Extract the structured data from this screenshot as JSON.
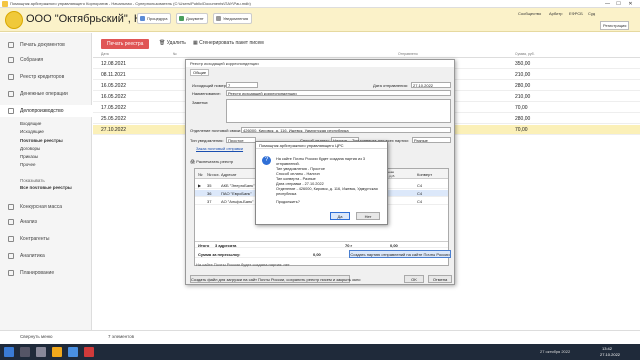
{
  "titlebar": {
    "title": "Помощник арбитражного управляющего Корпоратив - Начальная - Суперпользователь (C:\\Users\\Public\\Documents\\ПАУ\\Pau.mdb)",
    "min": "—",
    "max": "☐",
    "close": "✕"
  },
  "header": {
    "company": "ООО \"Октябрьский\", КП",
    "buttons": [
      "Процедура",
      "Документ",
      "Уведомления"
    ],
    "right": [
      "Сообщество",
      "Арбитр",
      "ЕФРСБ",
      "Суд",
      "Регистрация"
    ],
    "accent": "#e05555"
  },
  "sidebar": {
    "items": [
      "Печать документов",
      "Собрания",
      "Реестр кредиторов",
      "Денежные операции",
      "Делопроизводство",
      "Конкурсная масса",
      "Анализ",
      "Контрагенты",
      "Аналитика",
      "Планирование"
    ],
    "subitems": [
      "Входящие",
      "Исходящие",
      "Почтовые реестры",
      "Договоры",
      "Приказы",
      "Прочее"
    ],
    "show_label": "Показывать",
    "show_value": "Все почтовые реестры",
    "collapse": "Свернуть меню"
  },
  "main": {
    "print_btn": "Печать реестра",
    "delete_btn": "Удалить",
    "generate_btn": "Сгенерировать пакет писем",
    "headers": [
      "Дата",
      "№",
      "Отправлено",
      "Сумма, руб."
    ],
    "rows": [
      [
        "12.08.2021",
        "350,00"
      ],
      [
        "08.11.2021",
        "210,00"
      ],
      [
        "16.05.2022",
        "280,00"
      ],
      [
        "16.05.2022",
        "210,00"
      ],
      [
        "17.05.2022",
        "70,00"
      ],
      [
        "25.05.2022",
        "280,00"
      ],
      [
        "27.10.2022",
        "70,00"
      ]
    ],
    "footer": "7 элементов"
  },
  "dialog": {
    "title": "Реестр исходящей корреспонденции",
    "tab": "Общие",
    "outnum_label": "Исходящий номер:",
    "outnum": "7",
    "date_label": "Дата отправления:",
    "date": "27.10.2022",
    "name_label": "Наименование:",
    "name": "Реестр исходящей корреспонденции",
    "note_label": "Заметки:",
    "office_label": "Отделение почтовой связи:",
    "office": "426000, Кировск, д. 116, Ижевск, Удмуртская республика",
    "notif_label": "Тип уведомления:",
    "notif": "Простое",
    "payment_label": "Способ оплаты:",
    "payment": "Наличн",
    "envelope_label": "Тип конверта для всех партии:",
    "envelope": "Разные",
    "link": "Заказ почтовый отправки",
    "print_btn": "Распечатать реестр",
    "cols": [
      "№",
      "№ исх.",
      "Адресат",
      "Объявленная ценность, руб.",
      "Конверт"
    ],
    "rows": [
      [
        "35",
        "АКБ \"ЭнергоБанк\" (ПАО)",
        "С4"
      ],
      [
        "36",
        "ПАО \"ЕвроБанк\"",
        "С4"
      ],
      [
        "37",
        "АО \"Альфа-Банк\"",
        "С4"
      ]
    ],
    "total_label": "Итого",
    "total_count": "3 адресата",
    "total_sum": "70 г",
    "total_value": "0,00",
    "send_label": "Сумма за пересылку:",
    "send_value": "0,00",
    "create_btn": "Создать партию отправлений на сайте Почты России",
    "party_note": "На сайте Почты России будет создана партия: нет",
    "file_btn": "Создать файл для загрузки на сайт Почты России, сохранить реестр писем и закрыть окно",
    "ok": "OK",
    "cancel": "Отмена"
  },
  "msgbox": {
    "title": "Помощник арбитражного управляющего ЦРС",
    "lines": [
      "На сайте Почты России будет создана партия из 3",
      "отправлений.",
      "Тип уведомления - Простое",
      "Способ оплаты - Наличн",
      "Тип конверта - Разные",
      "Дата отправки - 27.10.2022",
      "Отделение - 426000, Кировск, д. 116, Ижевск, Удмуртская",
      "республика",
      "",
      "Продолжить?"
    ],
    "yes": "Да",
    "no": "Нет"
  },
  "taskbar": {
    "weather": "27 октября 2022",
    "time": "13:42",
    "date": "27.10.2022"
  }
}
